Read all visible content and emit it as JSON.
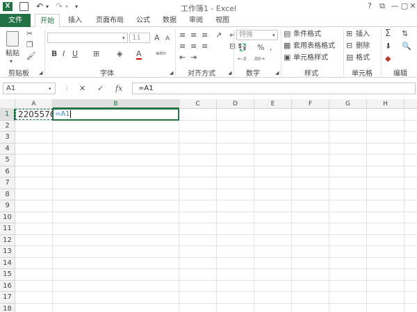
{
  "window": {
    "title": "工作簿1 - Excel",
    "help": "?",
    "minimize": "—",
    "restore": "▢",
    "close": "✕",
    "restore_ribbon": "⧉"
  },
  "qat": {
    "undo": "↶",
    "redo": "↷",
    "more": "▾"
  },
  "tabs": [
    {
      "label": "文件"
    },
    {
      "label": "开始"
    },
    {
      "label": "插入"
    },
    {
      "label": "页面布局"
    },
    {
      "label": "公式"
    },
    {
      "label": "数据"
    },
    {
      "label": "审阅"
    },
    {
      "label": "视图"
    }
  ],
  "ribbon": {
    "clipboard": {
      "label": "剪贴板",
      "paste": "粘贴"
    },
    "font": {
      "label": "字体",
      "font_size": "11",
      "bold": "B",
      "italic": "I",
      "underline": "U",
      "grow": "A",
      "shrink": "A",
      "wen": "wén"
    },
    "alignment": {
      "label": "对齐方式"
    },
    "number": {
      "label": "数字",
      "format": "特殊",
      "percent": "%",
      "comma": ","
    },
    "styles": {
      "label": "样式",
      "conditional": "条件格式",
      "table": "套用表格格式",
      "cell": "单元格样式"
    },
    "cells": {
      "label": "单元格",
      "insert": "插入",
      "delete": "删除",
      "format": "格式"
    },
    "editing": {
      "label": "编辑",
      "sum": "Σ"
    }
  },
  "formula_bar": {
    "name_box": "A1",
    "fx": "fx",
    "cancel": "✕",
    "enter": "✓",
    "formula": "=A1"
  },
  "columns": [
    {
      "label": "A",
      "width": 54
    },
    {
      "label": "B",
      "width": 182
    },
    {
      "label": "C",
      "width": 54
    },
    {
      "label": "D",
      "width": 54
    },
    {
      "label": "E",
      "width": 54
    },
    {
      "label": "F",
      "width": 54
    },
    {
      "label": "G",
      "width": 54
    },
    {
      "label": "H",
      "width": 54
    },
    {
      "label": "",
      "width": 20
    }
  ],
  "rows": [
    "1",
    "2",
    "3",
    "4",
    "5",
    "6",
    "7",
    "8",
    "9",
    "10",
    "11",
    "12",
    "13",
    "14",
    "15",
    "16",
    "17",
    "18"
  ],
  "cells": {
    "A1": "2205576",
    "B1_edit": "=A1"
  },
  "colors": {
    "accent": "#217346",
    "ref": "#3c7dc4"
  }
}
